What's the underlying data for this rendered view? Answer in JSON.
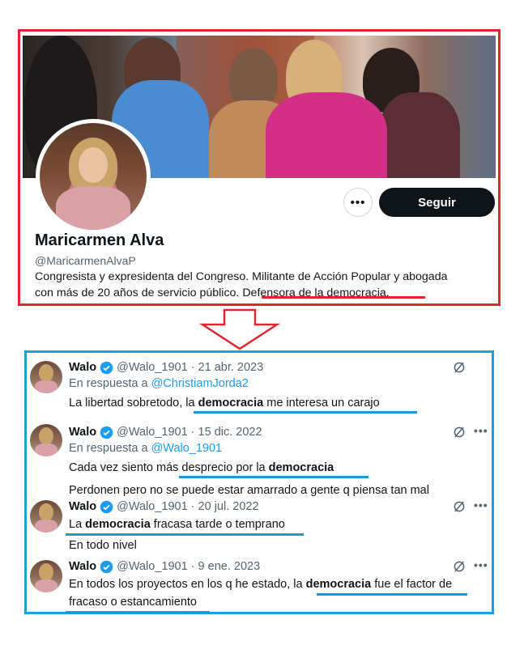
{
  "profile": {
    "display_name": "Maricarmen Alva",
    "handle": "@MaricarmenAlvaP",
    "bio_line1": "Congresista y expresidenta del Congreso. Militante de Acción Popular y abogada",
    "bio_line2_prefix": "con más de 20 años de servicio público. ",
    "bio_line2_highlight": "Defensora de la democracia.",
    "follow_label": "Seguir",
    "more_label": "•••"
  },
  "tweets": [
    {
      "author": "Walo",
      "meta": "@Walo_1901 · 21 abr. 2023",
      "reply_prefix": "En respuesta a ",
      "reply_mention": "@ChristiamJorda2",
      "text_line1_pre": "La libertad sobretodo, la ",
      "text_line1_bold": "democracia",
      "text_line1_post": " me interesa un carajo"
    },
    {
      "author": "Walo",
      "meta": "@Walo_1901 · 15 dic. 2022",
      "reply_prefix": "En respuesta a ",
      "reply_mention": "@Walo_1901",
      "text_line1_pre": "Cada vez siento más desprecio por la ",
      "text_line1_bold": "democracia",
      "text_line1_post": "",
      "text_line2": "Perdonen pero no se puede estar amarrado a gente q piensa tan mal"
    },
    {
      "author": "Walo",
      "meta": "@Walo_1901 · 20 jul. 2022",
      "text_line1_pre": "La ",
      "text_line1_bold": "democracia",
      "text_line1_post": " fracasa tarde o temprano",
      "text_line2": "En todo nivel"
    },
    {
      "author": "Walo",
      "meta": "@Walo_1901 · 9 ene. 2023",
      "text_line1_pre": "En todos los proyectos en los q he estado, la ",
      "text_line1_bold": "democracia",
      "text_line1_post": " fue el factor de",
      "text_line2": "fracaso o estancamiento"
    }
  ],
  "colors": {
    "profile_border": "#e0262c",
    "tweets_border": "#1da1dc",
    "verified": "#1d9bf0",
    "mention": "#1d9bf0",
    "follow_bg": "#0f1419"
  },
  "icons": [
    "more-horizontal-icon",
    "verified-badge-icon",
    "grok-icon",
    "down-arrow-icon"
  ]
}
